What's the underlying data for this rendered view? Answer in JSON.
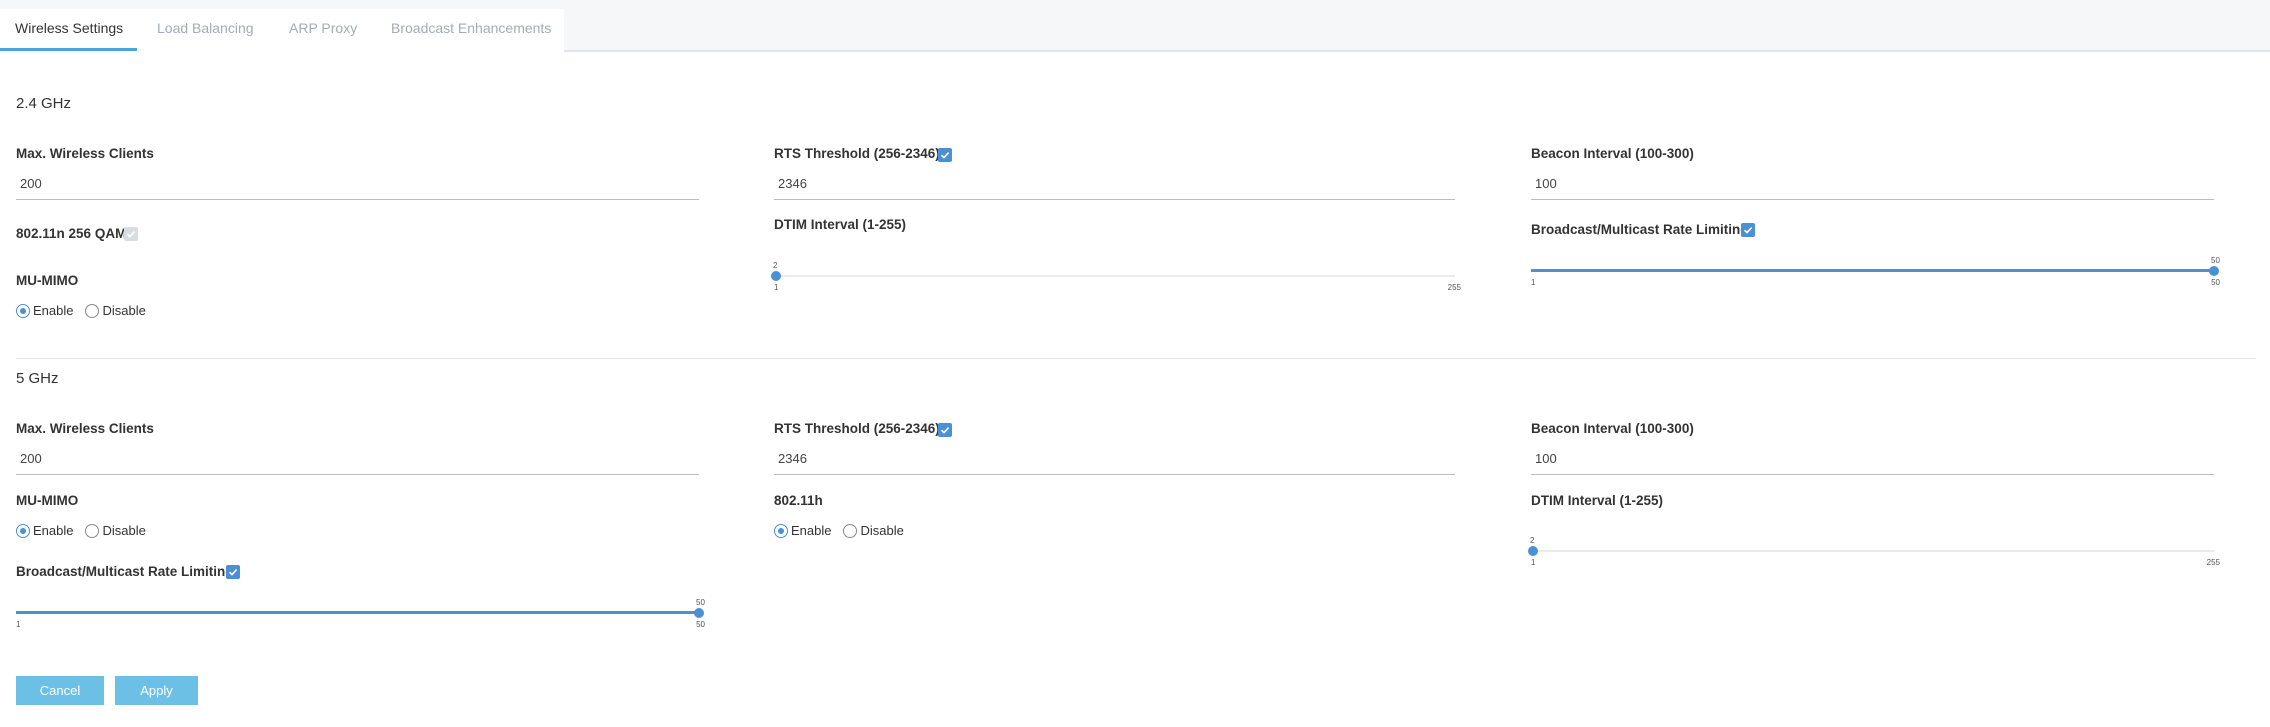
{
  "tabs": [
    {
      "label": "Wireless Settings",
      "active": true
    },
    {
      "label": "Load Balancing",
      "active": false
    },
    {
      "label": "ARP Proxy",
      "active": false
    },
    {
      "label": "Broadcast Enhancements",
      "active": false
    }
  ],
  "band24": {
    "title": "2.4 GHz",
    "max_clients_label": "Max. Wireless Clients",
    "max_clients_value": "200",
    "rts_label": "RTS Threshold (256-2346)",
    "rts_checked": true,
    "rts_value": "2346",
    "beacon_label": "Beacon Interval (100-300)",
    "beacon_value": "100",
    "qam_label": "802.11n 256 QAM",
    "qam_checked": true,
    "dtim_label": "DTIM Interval (1-255)",
    "dtim": {
      "value": "2",
      "min": "1",
      "max": "255"
    },
    "bcast_label": "Broadcast/Multicast Rate Limiting",
    "bcast_checked": true,
    "bcast": {
      "value": "50",
      "min": "1",
      "max": "50"
    },
    "mumimo_label": "MU-MIMO",
    "mumimo_options": {
      "enable": "Enable",
      "disable": "Disable",
      "selected": "Enable"
    }
  },
  "band5": {
    "title": "5 GHz",
    "max_clients_label": "Max. Wireless Clients",
    "max_clients_value": "200",
    "rts_label": "RTS Threshold (256-2346)",
    "rts_checked": true,
    "rts_value": "2346",
    "beacon_label": "Beacon Interval (100-300)",
    "beacon_value": "100",
    "mumimo_label": "MU-MIMO",
    "mumimo_options": {
      "enable": "Enable",
      "disable": "Disable",
      "selected": "Enable"
    },
    "dot11h_label": "802.11h",
    "dot11h_options": {
      "enable": "Enable",
      "disable": "Disable",
      "selected": "Enable"
    },
    "dtim_label": "DTIM Interval (1-255)",
    "dtim": {
      "value": "2",
      "min": "1",
      "max": "255"
    },
    "bcast_label": "Broadcast/Multicast Rate Limiting",
    "bcast_checked": true,
    "bcast": {
      "value": "50",
      "min": "1",
      "max": "50"
    }
  },
  "buttons": {
    "cancel": "Cancel",
    "apply": "Apply"
  },
  "colors": {
    "accent": "#4b8fd4",
    "tab_underline": "#48a7d8",
    "button": "#6cc0e6"
  }
}
